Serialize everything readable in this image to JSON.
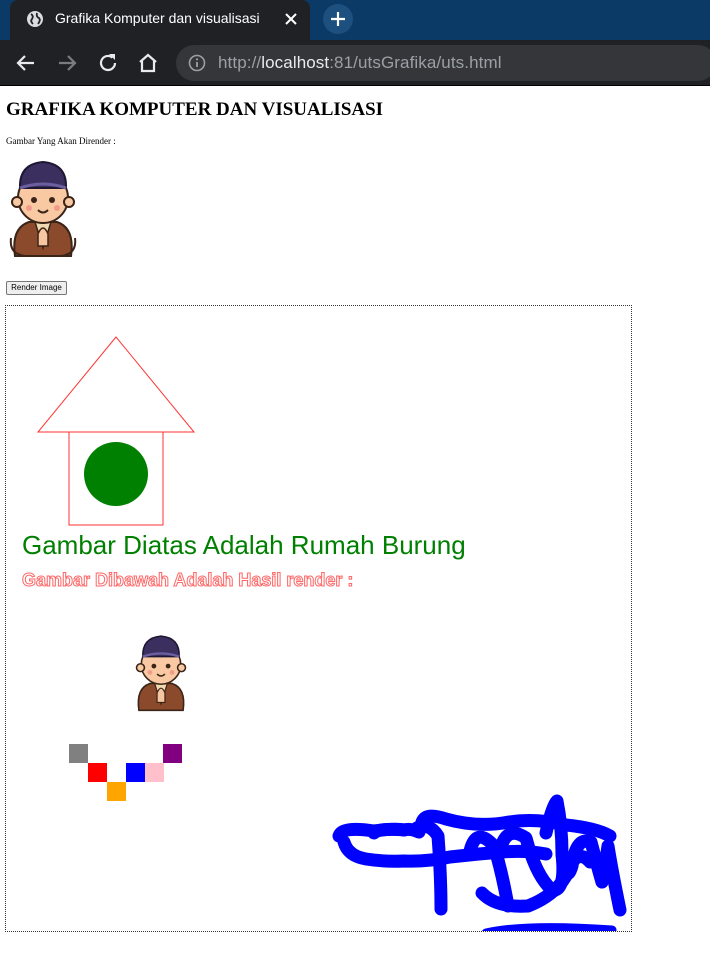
{
  "browser": {
    "tab_title": "Grafika Komputer dan visualisasi",
    "url_scheme": "http://",
    "url_host": "localhost",
    "url_rest": ":81/utsGrafika/uts.html"
  },
  "page": {
    "title": "GRAFIKA KOMPUTER DAN VISUALISASI",
    "caption": "Gambar Yang Akan Dirender :",
    "render_button": "Render Image"
  },
  "canvas": {
    "heading": "Gambar Diatas Adalah Rumah Burung",
    "subheading": "Gambar Dibawah Adalah Hasil render :",
    "colors": {
      "house_outline": "#ff3333",
      "circle": "#008000",
      "heading": "#008000",
      "subheading_stroke": "#ff6666",
      "signature": "#0000ff"
    },
    "pixel_colors": [
      "gray",
      "red",
      "orange",
      "blue",
      "pink",
      "purple"
    ]
  }
}
